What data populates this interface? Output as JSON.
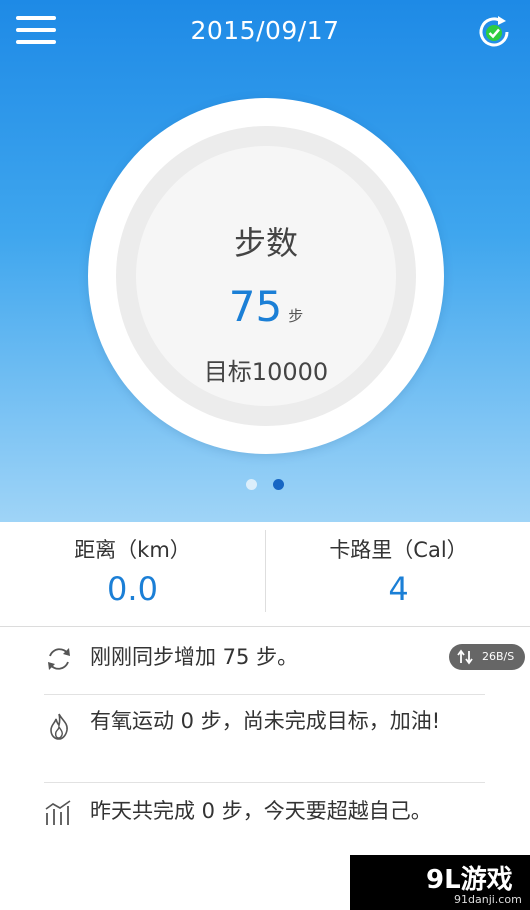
{
  "header": {
    "date": "2015/09/17",
    "menu_icon": "menu-icon",
    "sync_icon": "sync-check-icon"
  },
  "dashboard": {
    "title": "步数",
    "steps": "75",
    "steps_unit": "步",
    "goal": "目标10000",
    "pages_total": 2,
    "active_page": 2
  },
  "stats": {
    "distance_label": "距离（km）",
    "distance_value": "0.0",
    "calorie_label": "卡路里（Cal）",
    "calorie_value": "4"
  },
  "feed": [
    {
      "icon": "sync-icon",
      "text": "刚刚同步增加 75 步。"
    },
    {
      "icon": "flame-icon",
      "text": "有氧运动 0 步，尚未完成目标，加油!"
    },
    {
      "icon": "chart-icon",
      "text": "昨天共完成 0 步，今天要超越自己。"
    }
  ],
  "network": {
    "speed": "26B/S"
  },
  "watermark": {
    "logo": "9L游戏",
    "site": "91danji.com"
  },
  "colors": {
    "accent": "#1b7fd6",
    "header_blue": "#1e8ae6",
    "active_dot": "#1766c4",
    "sync_check": "#2ecc40"
  }
}
